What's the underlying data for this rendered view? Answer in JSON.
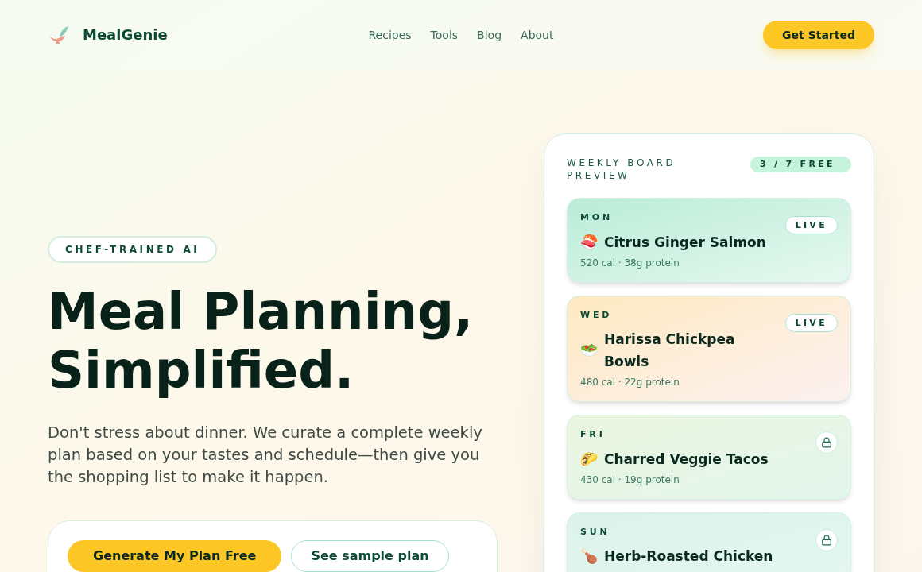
{
  "brand": {
    "name": "MealGenie"
  },
  "nav": [
    "Recipes",
    "Tools",
    "Blog",
    "About"
  ],
  "cta": "Get Started",
  "hero": {
    "badge": "CHEF-TRAINED AI",
    "title_lines": [
      "Meal Planning,",
      "Simplified."
    ],
    "text": "Don't stress about dinner. We curate a complete weekly plan based on your tastes and schedule—then give you the shopping list to make it happen.",
    "primary_button": "Generate My Plan Free",
    "secondary_button": "See sample plan"
  },
  "board": {
    "title": "WEEKLY BOARD PREVIEW",
    "counter": "3 / 7 FREE",
    "meals": [
      {
        "day": "MON",
        "emoji": "🍣",
        "name": "Citrus Ginger Salmon",
        "stats": "520 cal · 38g protein",
        "kind": "live",
        "status": "LIVE"
      },
      {
        "day": "WED",
        "emoji": "🥗",
        "name": "Harissa Chickpea Bowls",
        "stats": "480 cal · 22g protein",
        "kind": "live",
        "status": "LIVE"
      },
      {
        "day": "FRI",
        "emoji": "🌮",
        "name": "Charred Veggie Tacos",
        "stats": "430 cal · 19g protein",
        "kind": "locked"
      },
      {
        "day": "SUN",
        "emoji": "🍗",
        "name": "Herb-Roasted Chicken",
        "kind": "locked"
      }
    ]
  }
}
